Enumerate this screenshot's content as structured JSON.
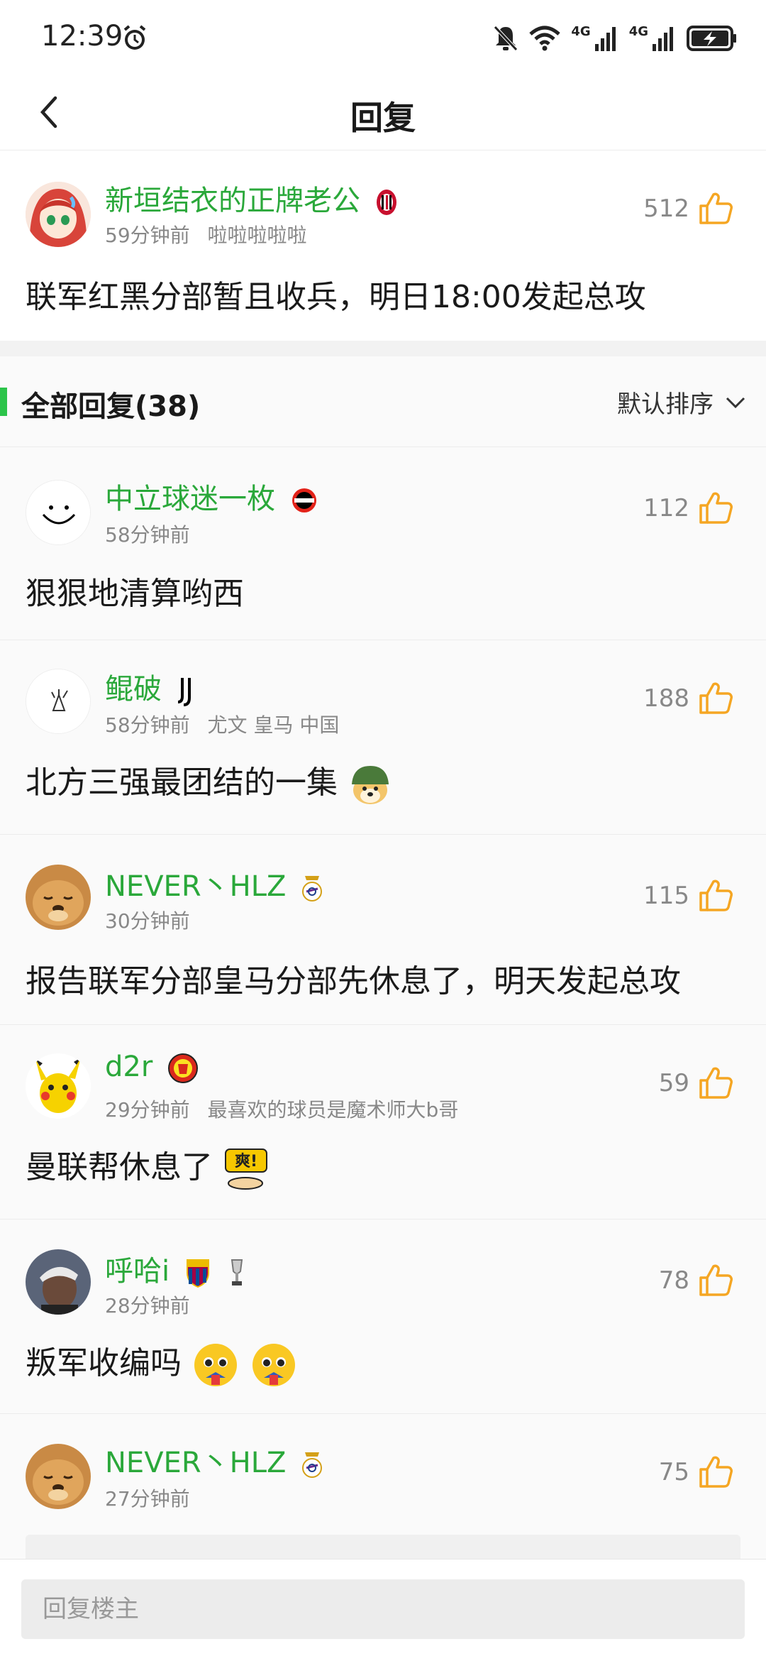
{
  "status_bar": {
    "time": "12:39",
    "net1": "4G",
    "net2": "4G"
  },
  "header": {
    "title": "回复"
  },
  "main_comment": {
    "user": "新垣结衣的正牌老公",
    "time": "59分钟前",
    "signature": "啦啦啦啦啦",
    "likes": "512",
    "text": "联军红黑分部暂且收兵，明日18:00发起总攻"
  },
  "replies_header": {
    "title": "全部回复(38)",
    "sort_label": "默认排序"
  },
  "replies": [
    {
      "user": "中立球迷一枚",
      "time": "58分钟前",
      "signature": "",
      "likes": "112",
      "text": "狠狠地清算哟西"
    },
    {
      "user": "鲲破",
      "time": "58分钟前",
      "signature": "尤文 皇马 中国",
      "likes": "188",
      "text": "北方三强最团结的一集"
    },
    {
      "user": "NEVER丶HLZ",
      "time": "30分钟前",
      "signature": "",
      "likes": "115",
      "text": "报告联军分部皇马分部先休息了，明天发起总攻"
    },
    {
      "user": "d2r",
      "time": "29分钟前",
      "signature": "最喜欢的球员是魔术师大b哥",
      "likes": "59",
      "text": "曼联帮休息了"
    },
    {
      "user": "呼哈i",
      "time": "28分钟前",
      "signature": "",
      "likes": "78",
      "text": "叛军收编吗"
    },
    {
      "user": "NEVER丶HLZ",
      "time": "27分钟前",
      "signature": "",
      "likes": "75",
      "text": ""
    }
  ],
  "emoji_text": {
    "shuang": "爽!"
  },
  "bottom": {
    "placeholder": "回复楼主"
  },
  "colors": {
    "username": "#2aa83a",
    "like": "#f5a623",
    "accent_bar": "#2cc44a"
  }
}
